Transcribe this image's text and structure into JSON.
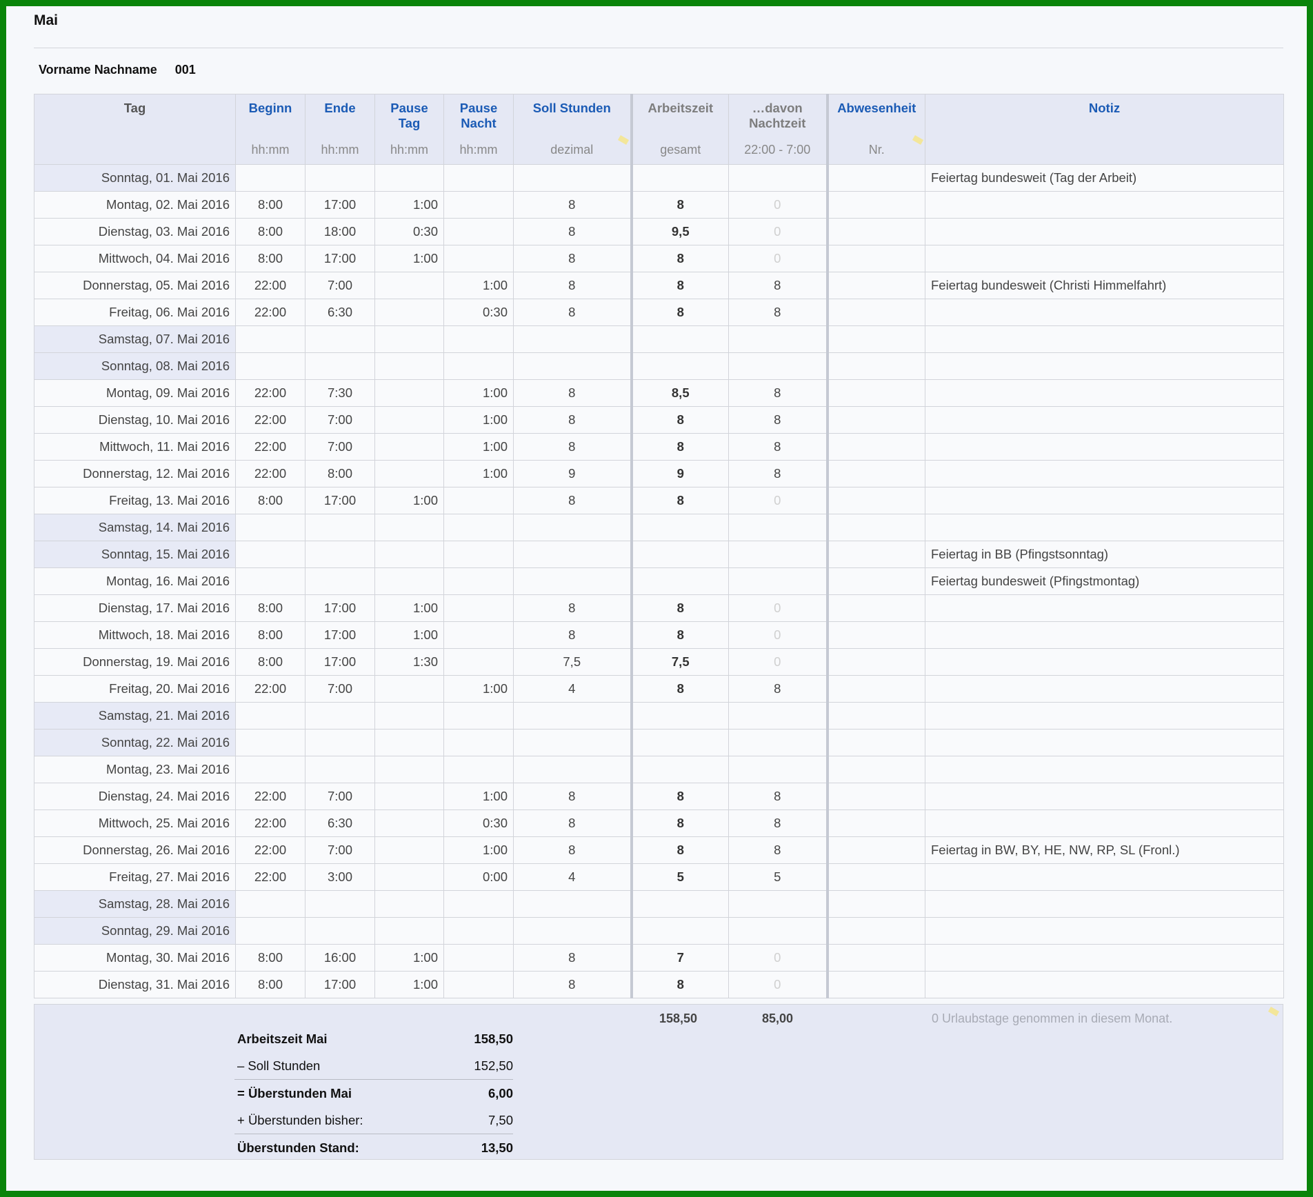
{
  "title": "Mai",
  "person": {
    "name": "Vorname Nachname",
    "id": "001"
  },
  "headers": {
    "tag": "Tag",
    "beginn": "Beginn",
    "beginn_sub": "hh:mm",
    "ende": "Ende",
    "ende_sub": "hh:mm",
    "pause_tag_1": "Pause",
    "pause_tag_2": "Tag",
    "pause_tag_sub": "hh:mm",
    "pause_nacht_1": "Pause",
    "pause_nacht_2": "Nacht",
    "pause_nacht_sub": "hh:mm",
    "soll": "Soll Stunden",
    "soll_sub": "dezimal",
    "arbeitszeit": "Arbeitszeit",
    "arbeitszeit_sub": "gesamt",
    "nacht_1": "…davon",
    "nacht_2": "Nachtzeit",
    "nacht_sub": "22:00 - 7:00",
    "abwesenheit": "Abwesenheit",
    "abwesenheit_sub": "Nr.",
    "notiz": "Notiz"
  },
  "rows": [
    {
      "tag": "Sonntag, 01. Mai 2016",
      "we": true,
      "beginn": "",
      "ende": "",
      "pt": "",
      "pn": "",
      "soll": "",
      "arb": "",
      "nacht": "",
      "abw": "",
      "notiz": "Feiertag bundesweit (Tag der Arbeit)"
    },
    {
      "tag": "Montag, 02. Mai 2016",
      "we": false,
      "beginn": "8:00",
      "ende": "17:00",
      "pt": "1:00",
      "pn": "",
      "soll": "8",
      "arb": "8",
      "nacht": "0",
      "abw": "",
      "notiz": ""
    },
    {
      "tag": "Dienstag, 03. Mai 2016",
      "we": false,
      "beginn": "8:00",
      "ende": "18:00",
      "pt": "0:30",
      "pn": "",
      "soll": "8",
      "arb": "9,5",
      "nacht": "0",
      "abw": "",
      "notiz": ""
    },
    {
      "tag": "Mittwoch, 04. Mai 2016",
      "we": false,
      "beginn": "8:00",
      "ende": "17:00",
      "pt": "1:00",
      "pn": "",
      "soll": "8",
      "arb": "8",
      "nacht": "0",
      "abw": "",
      "notiz": ""
    },
    {
      "tag": "Donnerstag, 05. Mai 2016",
      "we": false,
      "beginn": "22:00",
      "ende": "7:00",
      "pt": "",
      "pn": "1:00",
      "soll": "8",
      "arb": "8",
      "nacht": "8",
      "abw": "",
      "notiz": "Feiertag bundesweit (Christi Himmelfahrt)"
    },
    {
      "tag": "Freitag, 06. Mai 2016",
      "we": false,
      "beginn": "22:00",
      "ende": "6:30",
      "pt": "",
      "pn": "0:30",
      "soll": "8",
      "arb": "8",
      "nacht": "8",
      "abw": "",
      "notiz": ""
    },
    {
      "tag": "Samstag, 07. Mai 2016",
      "we": true,
      "beginn": "",
      "ende": "",
      "pt": "",
      "pn": "",
      "soll": "",
      "arb": "",
      "nacht": "",
      "abw": "",
      "notiz": ""
    },
    {
      "tag": "Sonntag, 08. Mai 2016",
      "we": true,
      "beginn": "",
      "ende": "",
      "pt": "",
      "pn": "",
      "soll": "",
      "arb": "",
      "nacht": "",
      "abw": "",
      "notiz": ""
    },
    {
      "tag": "Montag, 09. Mai 2016",
      "we": false,
      "beginn": "22:00",
      "ende": "7:30",
      "pt": "",
      "pn": "1:00",
      "soll": "8",
      "arb": "8,5",
      "nacht": "8",
      "abw": "",
      "notiz": ""
    },
    {
      "tag": "Dienstag, 10. Mai 2016",
      "we": false,
      "beginn": "22:00",
      "ende": "7:00",
      "pt": "",
      "pn": "1:00",
      "soll": "8",
      "arb": "8",
      "nacht": "8",
      "abw": "",
      "notiz": ""
    },
    {
      "tag": "Mittwoch, 11. Mai 2016",
      "we": false,
      "beginn": "22:00",
      "ende": "7:00",
      "pt": "",
      "pn": "1:00",
      "soll": "8",
      "arb": "8",
      "nacht": "8",
      "abw": "",
      "notiz": ""
    },
    {
      "tag": "Donnerstag, 12. Mai 2016",
      "we": false,
      "beginn": "22:00",
      "ende": "8:00",
      "pt": "",
      "pn": "1:00",
      "soll": "9",
      "arb": "9",
      "nacht": "8",
      "abw": "",
      "notiz": ""
    },
    {
      "tag": "Freitag, 13. Mai 2016",
      "we": false,
      "beginn": "8:00",
      "ende": "17:00",
      "pt": "1:00",
      "pn": "",
      "soll": "8",
      "arb": "8",
      "nacht": "0",
      "abw": "",
      "notiz": ""
    },
    {
      "tag": "Samstag, 14. Mai 2016",
      "we": true,
      "beginn": "",
      "ende": "",
      "pt": "",
      "pn": "",
      "soll": "",
      "arb": "",
      "nacht": "",
      "abw": "",
      "notiz": ""
    },
    {
      "tag": "Sonntag, 15. Mai 2016",
      "we": true,
      "beginn": "",
      "ende": "",
      "pt": "",
      "pn": "",
      "soll": "",
      "arb": "",
      "nacht": "",
      "abw": "",
      "notiz": "Feiertag in BB (Pfingstsonntag)"
    },
    {
      "tag": "Montag, 16. Mai 2016",
      "we": false,
      "beginn": "",
      "ende": "",
      "pt": "",
      "pn": "",
      "soll": "",
      "arb": "",
      "nacht": "",
      "abw": "",
      "notiz": "Feiertag bundesweit (Pfingstmontag)"
    },
    {
      "tag": "Dienstag, 17. Mai 2016",
      "we": false,
      "beginn": "8:00",
      "ende": "17:00",
      "pt": "1:00",
      "pn": "",
      "soll": "8",
      "arb": "8",
      "nacht": "0",
      "abw": "",
      "notiz": ""
    },
    {
      "tag": "Mittwoch, 18. Mai 2016",
      "we": false,
      "beginn": "8:00",
      "ende": "17:00",
      "pt": "1:00",
      "pn": "",
      "soll": "8",
      "arb": "8",
      "nacht": "0",
      "abw": "",
      "notiz": ""
    },
    {
      "tag": "Donnerstag, 19. Mai 2016",
      "we": false,
      "beginn": "8:00",
      "ende": "17:00",
      "pt": "1:30",
      "pn": "",
      "soll": "7,5",
      "arb": "7,5",
      "nacht": "0",
      "abw": "",
      "notiz": ""
    },
    {
      "tag": "Freitag, 20. Mai 2016",
      "we": false,
      "beginn": "22:00",
      "ende": "7:00",
      "pt": "",
      "pn": "1:00",
      "soll": "4",
      "arb": "8",
      "nacht": "8",
      "abw": "",
      "notiz": ""
    },
    {
      "tag": "Samstag, 21. Mai 2016",
      "we": true,
      "beginn": "",
      "ende": "",
      "pt": "",
      "pn": "",
      "soll": "",
      "arb": "",
      "nacht": "",
      "abw": "",
      "notiz": ""
    },
    {
      "tag": "Sonntag, 22. Mai 2016",
      "we": true,
      "beginn": "",
      "ende": "",
      "pt": "",
      "pn": "",
      "soll": "",
      "arb": "",
      "nacht": "",
      "abw": "",
      "notiz": ""
    },
    {
      "tag": "Montag, 23. Mai 2016",
      "we": false,
      "beginn": "",
      "ende": "",
      "pt": "",
      "pn": "",
      "soll": "",
      "arb": "",
      "nacht": "",
      "abw": "",
      "notiz": ""
    },
    {
      "tag": "Dienstag, 24. Mai 2016",
      "we": false,
      "beginn": "22:00",
      "ende": "7:00",
      "pt": "",
      "pn": "1:00",
      "soll": "8",
      "arb": "8",
      "nacht": "8",
      "abw": "",
      "notiz": ""
    },
    {
      "tag": "Mittwoch, 25. Mai 2016",
      "we": false,
      "beginn": "22:00",
      "ende": "6:30",
      "pt": "",
      "pn": "0:30",
      "soll": "8",
      "arb": "8",
      "nacht": "8",
      "abw": "",
      "notiz": ""
    },
    {
      "tag": "Donnerstag, 26. Mai 2016",
      "we": false,
      "beginn": "22:00",
      "ende": "7:00",
      "pt": "",
      "pn": "1:00",
      "soll": "8",
      "arb": "8",
      "nacht": "8",
      "abw": "",
      "notiz": "Feiertag in BW, BY, HE, NW, RP, SL (Fronl.)"
    },
    {
      "tag": "Freitag, 27. Mai 2016",
      "we": false,
      "beginn": "22:00",
      "ende": "3:00",
      "pt": "",
      "pn": "0:00",
      "soll": "4",
      "arb": "5",
      "nacht": "5",
      "abw": "",
      "notiz": ""
    },
    {
      "tag": "Samstag, 28. Mai 2016",
      "we": true,
      "beginn": "",
      "ende": "",
      "pt": "",
      "pn": "",
      "soll": "",
      "arb": "",
      "nacht": "",
      "abw": "",
      "notiz": ""
    },
    {
      "tag": "Sonntag, 29. Mai 2016",
      "we": true,
      "beginn": "",
      "ende": "",
      "pt": "",
      "pn": "",
      "soll": "",
      "arb": "",
      "nacht": "",
      "abw": "",
      "notiz": ""
    },
    {
      "tag": "Montag, 30. Mai 2016",
      "we": false,
      "beginn": "8:00",
      "ende": "16:00",
      "pt": "1:00",
      "pn": "",
      "soll": "8",
      "arb": "7",
      "nacht": "0",
      "abw": "",
      "notiz": ""
    },
    {
      "tag": "Dienstag, 31. Mai 2016",
      "we": false,
      "beginn": "8:00",
      "ende": "17:00",
      "pt": "1:00",
      "pn": "",
      "soll": "8",
      "arb": "8",
      "nacht": "0",
      "abw": "",
      "notiz": ""
    }
  ],
  "totals": {
    "arbeitszeit": "158,50",
    "nachtzeit": "85,00",
    "urlaub_note": "0 Urlaubstage genommen in diesem Monat."
  },
  "summary": [
    {
      "label": "Arbeitszeit Mai",
      "value": "158,50",
      "bold": true,
      "line": false
    },
    {
      "label": "– Soll Stunden",
      "value": "152,50",
      "bold": false,
      "line": false
    },
    {
      "label": "= Überstunden Mai",
      "value": "6,00",
      "bold": true,
      "line": true
    },
    {
      "label": "+ Überstunden bisher:",
      "value": "7,50",
      "bold": false,
      "line": false
    },
    {
      "label": "Überstunden Stand:",
      "value": "13,50",
      "bold": true,
      "line": true
    }
  ],
  "colors": {
    "frame": "#0a840a",
    "header_bg": "#e5e8f4",
    "header_blue": "#1b5bb5",
    "weekend_bg": "#e7eaf6"
  }
}
